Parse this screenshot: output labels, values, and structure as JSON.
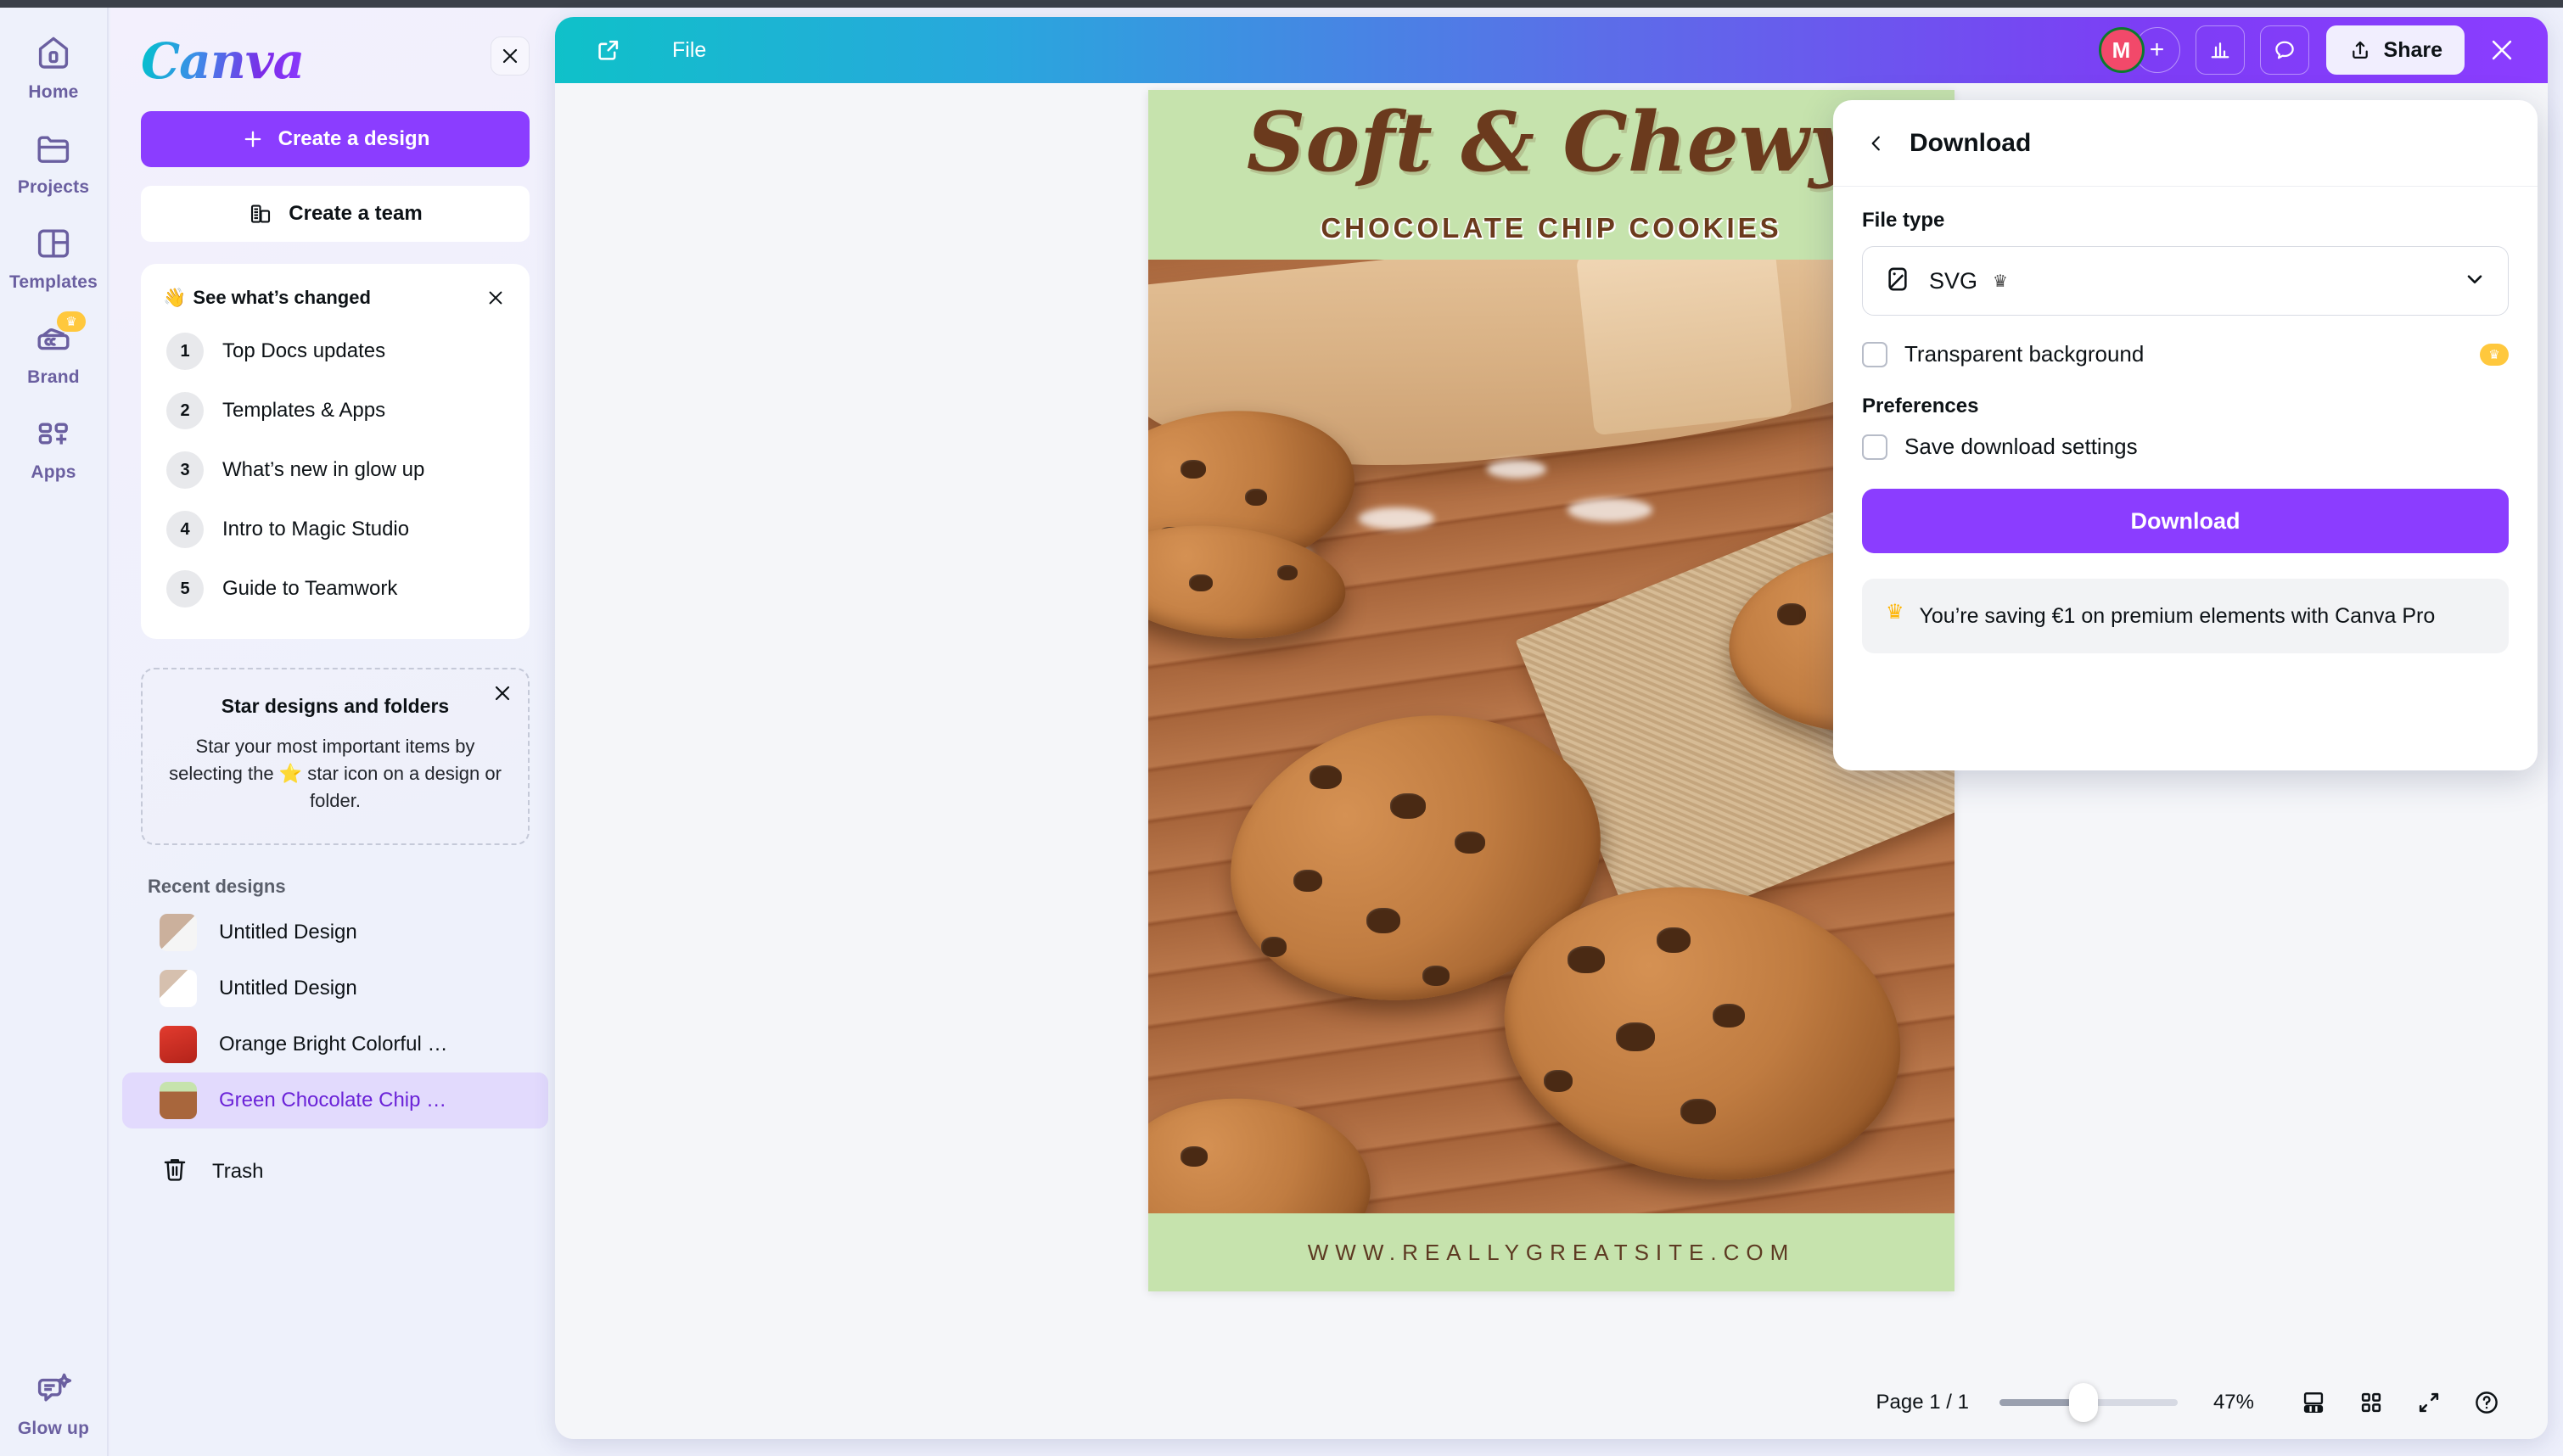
{
  "app": {
    "logo_text": "Canva"
  },
  "rail": {
    "items": [
      {
        "label": "Home",
        "icon": "home-icon",
        "badge": ""
      },
      {
        "label": "Projects",
        "icon": "folder-icon",
        "badge": ""
      },
      {
        "label": "Templates",
        "icon": "templates-icon",
        "badge": ""
      },
      {
        "label": "Brand",
        "icon": "brand-icon",
        "badge": "crown"
      },
      {
        "label": "Apps",
        "icon": "apps-icon",
        "badge": ""
      }
    ],
    "bottom": {
      "label": "Glow up",
      "icon": "glow-up-icon"
    }
  },
  "sidebar": {
    "close_label": "×",
    "create_design_label": "Create a design",
    "create_team_label": "Create a team",
    "whats_changed": {
      "title": "See what’s changed",
      "emoji": "👋",
      "items": [
        {
          "num": "1",
          "label": "Top Docs updates"
        },
        {
          "num": "2",
          "label": "Templates & Apps"
        },
        {
          "num": "3",
          "label": "What’s new in glow up"
        },
        {
          "num": "4",
          "label": "Intro to Magic Studio"
        },
        {
          "num": "5",
          "label": "Guide to Teamwork"
        }
      ]
    },
    "star_card": {
      "title": "Star designs and folders",
      "body": "Star your most important items by selecting the ⭐ star icon on a design or folder."
    },
    "recent_title": "Recent designs",
    "recent": [
      {
        "label": "Untitled Design",
        "active": false
      },
      {
        "label": "Untitled Design",
        "active": false
      },
      {
        "label": "Orange Bright Colorful …",
        "active": false
      },
      {
        "label": "Green Chocolate Chip …",
        "active": true
      }
    ],
    "trash_label": "Trash"
  },
  "toolbar": {
    "file_label": "File",
    "avatar_initial": "M",
    "plus_label": "+",
    "share_label": "Share",
    "close_label": "✕",
    "icons": [
      "open-in-new-icon",
      "insights-icon",
      "comment-icon",
      "share-upload-icon"
    ]
  },
  "poster": {
    "title": "Soft & Chewy",
    "subtitle": "CHOCOLATE CHIP COOKIES",
    "url": "WWW.REALLYGREATSITE.COM",
    "bg_color": "#c6e3ad",
    "text_color": "#6b3a1d"
  },
  "bottombar": {
    "page_label": "Page 1 / 1",
    "zoom_label": "47%",
    "zoom_value": 47,
    "icons": [
      "page-layout-icon",
      "grid-view-icon",
      "fullscreen-icon",
      "help-icon"
    ]
  },
  "download": {
    "title": "Download",
    "back_label": "‹",
    "file_type_label": "File type",
    "file_type_value": "SVG",
    "file_type_premium": true,
    "transparent_bg_label": "Transparent background",
    "transparent_bg_checked": false,
    "preferences_label": "Preferences",
    "save_settings_label": "Save download settings",
    "save_settings_checked": false,
    "download_button_label": "Download",
    "promo_text": "You’re saving €1 on premium elements with Canva Pro"
  },
  "colors": {
    "brand_purple": "#8b3dff",
    "toolbar_gradient_start": "#0fc1c9",
    "toolbar_gradient_end": "#8b3dff",
    "avatar_pink": "#f2496a",
    "avatar_ring_green": "#0a7a2e",
    "crown_yellow": "#ffc83d",
    "poster_green": "#c6e3ad",
    "poster_brown": "#6b3a1d",
    "active_item_purple": "#6b23d8"
  }
}
